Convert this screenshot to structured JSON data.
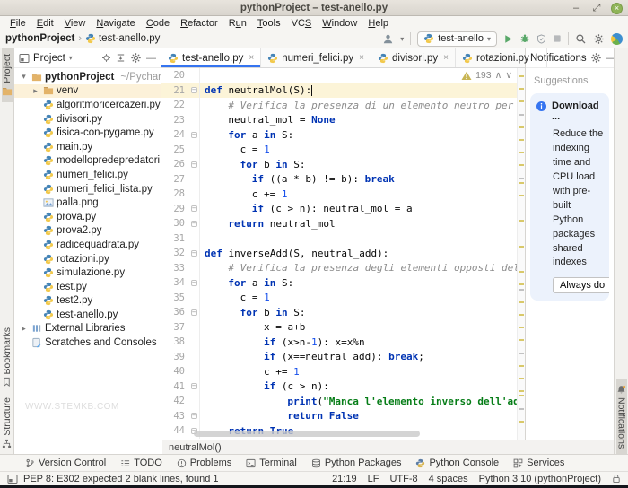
{
  "window": {
    "title": "pythonProject – test-anello.py"
  },
  "menu": {
    "items": [
      {
        "label": "File",
        "mn": 0
      },
      {
        "label": "Edit",
        "mn": 0
      },
      {
        "label": "View",
        "mn": 0
      },
      {
        "label": "Navigate",
        "mn": 0
      },
      {
        "label": "Code",
        "mn": 0
      },
      {
        "label": "Refactor",
        "mn": 0
      },
      {
        "label": "Run",
        "mn": 1
      },
      {
        "label": "Tools",
        "mn": 0
      },
      {
        "label": "VCS",
        "mn": 2
      },
      {
        "label": "Window",
        "mn": 0
      },
      {
        "label": "Help",
        "mn": 0
      }
    ]
  },
  "toolbar": {
    "crumb_project": "pythonProject",
    "crumb_file": "test-anello.py",
    "run_config": "test-anello"
  },
  "stripes": {
    "left_top": [
      {
        "label": "Project",
        "icon": "folder",
        "selected": true
      }
    ],
    "left_bottom": [
      {
        "label": "Bookmarks",
        "icon": "bookmark",
        "selected": false
      },
      {
        "label": "Structure",
        "icon": "structure",
        "selected": false
      }
    ],
    "right_bottom": [
      {
        "label": "Notifications",
        "icon": "bell",
        "selected": true
      }
    ]
  },
  "project_panel": {
    "title": "Project",
    "watermark": "WWW.STEMKB.COM",
    "items": [
      {
        "label": "pythonProject",
        "suffix": "~/PycharmProje",
        "type": "folder",
        "level": 0,
        "arrow": "down",
        "bold": true
      },
      {
        "label": "venv",
        "type": "folder",
        "level": 1,
        "arrow": "right",
        "highlight": true
      },
      {
        "label": "algoritmoricercazeri.py",
        "type": "py",
        "level": 1
      },
      {
        "label": "divisori.py",
        "type": "py",
        "level": 1
      },
      {
        "label": "fisica-con-pygame.py",
        "type": "py",
        "level": 1
      },
      {
        "label": "main.py",
        "type": "py",
        "level": 1
      },
      {
        "label": "modellopredepredatori.py",
        "type": "py",
        "level": 1
      },
      {
        "label": "numeri_felici.py",
        "type": "py",
        "level": 1
      },
      {
        "label": "numeri_felici_lista.py",
        "type": "py",
        "level": 1
      },
      {
        "label": "palla.png",
        "type": "img",
        "level": 1
      },
      {
        "label": "prova.py",
        "type": "py",
        "level": 1
      },
      {
        "label": "prova2.py",
        "type": "py",
        "level": 1
      },
      {
        "label": "radicequadrata.py",
        "type": "py",
        "level": 1
      },
      {
        "label": "rotazioni.py",
        "type": "py",
        "level": 1
      },
      {
        "label": "simulazione.py",
        "type": "py",
        "level": 1
      },
      {
        "label": "test.py",
        "type": "py",
        "level": 1
      },
      {
        "label": "test2.py",
        "type": "py",
        "level": 1
      },
      {
        "label": "test-anello.py",
        "type": "py",
        "level": 1
      },
      {
        "label": "External Libraries",
        "type": "lib",
        "level": 0,
        "arrow": "right"
      },
      {
        "label": "Scratches and Consoles",
        "type": "scratch",
        "level": 0
      }
    ]
  },
  "tabs": [
    {
      "label": "test-anello.py",
      "active": true
    },
    {
      "label": "numeri_felici.py",
      "active": false
    },
    {
      "label": "divisori.py",
      "active": false
    },
    {
      "label": "rotazioni.py",
      "active": false
    }
  ],
  "editor": {
    "warning_count": "193",
    "breadcrumb": "neutralMol()",
    "lines": [
      {
        "n": 20,
        "i": 0,
        "s": []
      },
      {
        "n": 21,
        "i": 0,
        "cur": true,
        "caret": true,
        "fold": true,
        "s": [
          [
            "kw",
            "def "
          ],
          [
            "pl",
            "neutralMol(S):"
          ]
        ]
      },
      {
        "n": 22,
        "i": 4,
        "s": [
          [
            "co",
            "# Verifica la presenza di un elemento neutro per la moltiplicazi"
          ]
        ]
      },
      {
        "n": 23,
        "i": 4,
        "s": [
          [
            "pl",
            "neutral_mol = "
          ],
          [
            "kw",
            "None"
          ]
        ]
      },
      {
        "n": 24,
        "i": 4,
        "fold": true,
        "s": [
          [
            "kw",
            "for "
          ],
          [
            "pl",
            "a "
          ],
          [
            "kw",
            "in "
          ],
          [
            "pl",
            "S:"
          ]
        ]
      },
      {
        "n": 25,
        "i": 6,
        "s": [
          [
            "pl",
            "c = "
          ],
          [
            "nu",
            "1"
          ]
        ]
      },
      {
        "n": 26,
        "i": 6,
        "fold": true,
        "s": [
          [
            "kw",
            "for "
          ],
          [
            "pl",
            "b "
          ],
          [
            "kw",
            "in "
          ],
          [
            "pl",
            "S:"
          ]
        ]
      },
      {
        "n": 27,
        "i": 8,
        "s": [
          [
            "kw",
            "if "
          ],
          [
            "pl",
            "((a * b) != b): "
          ],
          [
            "kw",
            "break"
          ]
        ]
      },
      {
        "n": 28,
        "i": 8,
        "s": [
          [
            "pl",
            "c += "
          ],
          [
            "nu",
            "1"
          ]
        ]
      },
      {
        "n": 29,
        "i": 8,
        "fold": true,
        "s": [
          [
            "kw",
            "if "
          ],
          [
            "pl",
            "(c > n): neutral_mol = a"
          ]
        ]
      },
      {
        "n": 30,
        "i": 4,
        "fold": true,
        "s": [
          [
            "kw",
            "return "
          ],
          [
            "pl",
            "neutral_mol"
          ]
        ]
      },
      {
        "n": 31,
        "i": 0,
        "s": []
      },
      {
        "n": 32,
        "i": 0,
        "fold": true,
        "s": [
          [
            "kw",
            "def "
          ],
          [
            "pl",
            "inverseAdd(S, neutral_add):"
          ]
        ]
      },
      {
        "n": 33,
        "i": 4,
        "s": [
          [
            "co",
            "# Verifica la presenza degli elementi opposti dell'addizione"
          ]
        ]
      },
      {
        "n": 34,
        "i": 4,
        "fold": true,
        "s": [
          [
            "kw",
            "for "
          ],
          [
            "pl",
            "a "
          ],
          [
            "kw",
            "in "
          ],
          [
            "pl",
            "S:"
          ]
        ]
      },
      {
        "n": 35,
        "i": 6,
        "s": [
          [
            "pl",
            "c = "
          ],
          [
            "nu",
            "1"
          ]
        ]
      },
      {
        "n": 36,
        "i": 6,
        "fold": true,
        "s": [
          [
            "kw",
            "for "
          ],
          [
            "pl",
            "b "
          ],
          [
            "kw",
            "in "
          ],
          [
            "pl",
            "S:"
          ]
        ]
      },
      {
        "n": 37,
        "i": 10,
        "s": [
          [
            "pl",
            "x = a+b"
          ]
        ]
      },
      {
        "n": 38,
        "i": 10,
        "s": [
          [
            "kw",
            "if "
          ],
          [
            "pl",
            "(x>n-"
          ],
          [
            "nu",
            "1"
          ],
          [
            "pl",
            "): x=x%n"
          ]
        ]
      },
      {
        "n": 39,
        "i": 10,
        "s": [
          [
            "kw",
            "if "
          ],
          [
            "pl",
            "(x==neutral_add): "
          ],
          [
            "kw",
            "break"
          ],
          [
            "pl",
            ";"
          ]
        ]
      },
      {
        "n": 40,
        "i": 10,
        "s": [
          [
            "pl",
            "c += "
          ],
          [
            "nu",
            "1"
          ]
        ]
      },
      {
        "n": 41,
        "i": 10,
        "fold": true,
        "s": [
          [
            "kw",
            "if "
          ],
          [
            "pl",
            "(c > n):"
          ]
        ]
      },
      {
        "n": 42,
        "i": 14,
        "s": [
          [
            "bi",
            "print"
          ],
          [
            "pl",
            "("
          ],
          [
            "st",
            "\"Manca l'elemento inverso dell'addizione per"
          ]
        ]
      },
      {
        "n": 43,
        "i": 14,
        "fold": true,
        "s": [
          [
            "kw",
            "return "
          ],
          [
            "kw",
            "False"
          ]
        ]
      },
      {
        "n": 44,
        "i": 4,
        "fold": true,
        "s": [
          [
            "kw",
            "return "
          ],
          [
            "kw",
            "True"
          ]
        ]
      }
    ]
  },
  "notifications": {
    "header": "Notifications",
    "section": "Suggestions",
    "card": {
      "title": "Download ...",
      "body": "Reduce the indexing time and CPU load with pre-built Python packages shared indexes",
      "button": "Always do"
    }
  },
  "toolwindows": [
    {
      "label": "Version Control",
      "icon": "branch"
    },
    {
      "label": "TODO",
      "icon": "todo"
    },
    {
      "label": "Problems",
      "icon": "problems"
    },
    {
      "label": "Terminal",
      "icon": "terminal"
    },
    {
      "label": "Python Packages",
      "icon": "packages"
    },
    {
      "label": "Python Console",
      "icon": "pyconsole"
    },
    {
      "label": "Services",
      "icon": "services"
    }
  ],
  "status_bar": {
    "message": "PEP 8: E302 expected 2 blank lines, found 1",
    "segments": [
      "21:19",
      "LF",
      "UTF-8",
      "4 spaces",
      "Python 3.10 (pythonProject)"
    ]
  },
  "colors": {
    "accent": "#3574F0",
    "run_green": "#59A869",
    "warning_stripe": "#d9c96a",
    "keyword": "#0033B3",
    "string": "#067D17",
    "number": "#1750EB",
    "comment": "#8C8C8C",
    "close_button_green": "#8fb457",
    "current_line": "#fcf4d8"
  }
}
